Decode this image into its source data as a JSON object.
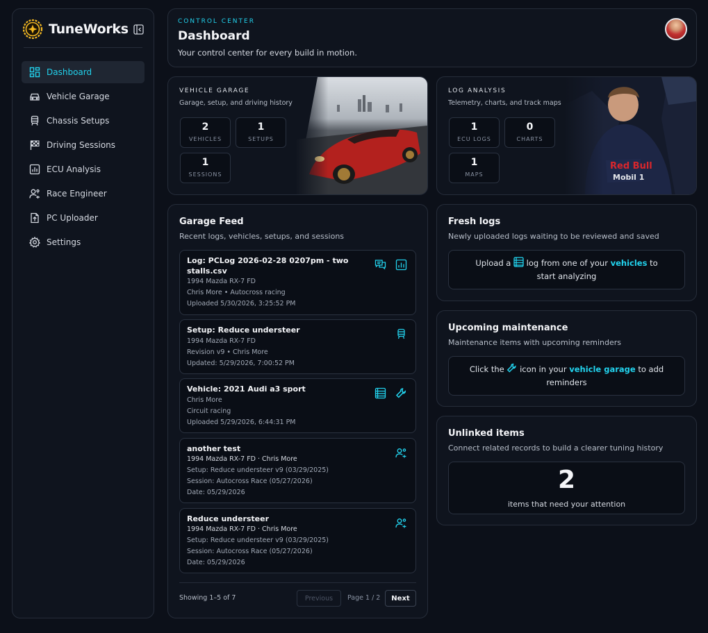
{
  "brand": {
    "name": "TuneWorks"
  },
  "sidebar": {
    "items": [
      {
        "label": "Dashboard",
        "icon": "dashboard-icon",
        "active": true
      },
      {
        "label": "Vehicle Garage",
        "icon": "car-icon"
      },
      {
        "label": "Chassis Setups",
        "icon": "chassis-icon"
      },
      {
        "label": "Driving Sessions",
        "icon": "checkered-flag-icon"
      },
      {
        "label": "ECU Analysis",
        "icon": "bar-chart-icon"
      },
      {
        "label": "Race Engineer",
        "icon": "engineer-icon"
      },
      {
        "label": "PC Uploader",
        "icon": "upload-file-icon"
      },
      {
        "label": "Settings",
        "icon": "gear-icon"
      }
    ]
  },
  "header": {
    "kicker": "CONTROL CENTER",
    "title": "Dashboard",
    "subtitle": "Your control center for every build in motion."
  },
  "vehicle_garage": {
    "label": "VEHICLE GARAGE",
    "description": "Garage, setup, and driving history",
    "stats": [
      {
        "value": "2",
        "label": "VEHICLES"
      },
      {
        "value": "1",
        "label": "SETUPS"
      },
      {
        "value": "1",
        "label": "SESSIONS"
      }
    ]
  },
  "log_analysis": {
    "label": "LOG ANALYSIS",
    "description": "Telemetry, charts, and track maps",
    "stats": [
      {
        "value": "1",
        "label": "ECU LOGS"
      },
      {
        "value": "0",
        "label": "CHARTS"
      },
      {
        "value": "1",
        "label": "MAPS"
      }
    ]
  },
  "feed": {
    "title": "Garage Feed",
    "subtitle": "Recent logs, vehicles, setups, and sessions",
    "items": [
      {
        "title": "Log: PCLog 2026-02-28 0207pm - two stalls.csv",
        "lines": [
          "1994 Mazda RX-7 FD",
          "Chris More • Autocross racing",
          "Uploaded 5/30/2026, 3:25:52 PM"
        ],
        "icons": [
          "comment-icon",
          "chart-icon"
        ]
      },
      {
        "title": "Setup: Reduce understeer",
        "lines": [
          "1994 Mazda RX-7 FD",
          "Revision v9 • Chris More",
          "Updated: 5/29/2026, 7:00:52 PM"
        ],
        "icons": [
          "chassis-icon"
        ]
      },
      {
        "title": "Vehicle: 2021 Audi a3 sport",
        "lines": [
          "Chris More",
          "Circuit racing",
          "Uploaded 5/29/2026, 6:44:31 PM"
        ],
        "icons": [
          "log-list-icon",
          "wrench-icon"
        ]
      },
      {
        "title": "another test",
        "lines": [
          "1994 Mazda RX-7 FD · Chris More",
          "Setup: Reduce understeer v9 (03/29/2025)",
          "Session: Autocross Race (05/27/2026)",
          "Date: 05/29/2026"
        ],
        "icons": [
          "engineer-icon"
        ]
      },
      {
        "title": "Reduce understeer",
        "lines": [
          "1994 Mazda RX-7 FD · Chris More",
          "Setup: Reduce understeer v9 (03/29/2025)",
          "Session: Autocross Race (05/27/2026)",
          "Date: 05/29/2026"
        ],
        "icons": [
          "engineer-icon"
        ]
      }
    ],
    "showing": "Showing 1–5 of 7",
    "prev_label": "Previous",
    "page_info": "Page 1 / 2",
    "next_label": "Next"
  },
  "fresh_logs": {
    "title": "Fresh logs",
    "subtitle": "Newly uploaded logs waiting to be reviewed and saved",
    "msg_pre": "Upload a",
    "msg_mid": "log from one of your",
    "msg_link": "vehicles",
    "msg_post": "to start analyzing"
  },
  "maintenance": {
    "title": "Upcoming maintenance",
    "subtitle": "Maintenance items with upcoming reminders",
    "msg_pre": "Click the",
    "msg_mid": "icon in your",
    "msg_link": "vehicle garage",
    "msg_post": "to add reminders"
  },
  "unlinked": {
    "title": "Unlinked items",
    "subtitle": "Connect related records to build a clearer tuning history",
    "count": "2",
    "count_label": "items that need your attention"
  },
  "colors": {
    "accent": "#22d3ee",
    "background": "#0c1019",
    "panel": "#0f141e"
  }
}
